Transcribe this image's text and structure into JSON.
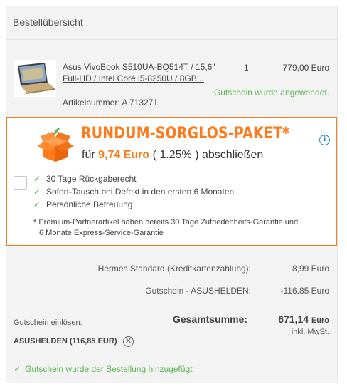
{
  "header": {
    "title": "Bestellübersicht"
  },
  "product": {
    "image_alt": "laptop-product-image",
    "name": "Asus VivoBook S510UA-BQ514T / 15,6\" Full-HD / Intel Core i5-8250U / 8GB...",
    "quantity": "1",
    "price": "779,00 Euro",
    "coupon_note": "Gutschein wurde angewendet.",
    "sku": "Artikelnummer: A 713271"
  },
  "care_package": {
    "title": "RUNDUM-SORGLOS-PAKET*",
    "price_prefix": "für ",
    "price_amount": "9,74 Euro",
    "price_middle": " ( 1.25% ) abschließen",
    "checked": false,
    "features": [
      "30 Tage Rückgaberecht",
      "Sofort-Tausch bei Defekt in den ersten 6 Monaten",
      "Persönliche Betreuung"
    ],
    "note_line1": "* Premium-Partnerartikel haben bereits 30 Tage Zufriedenheits-Garantie und",
    "note_line2": "6 Monate Express-Service-Garantie",
    "accent_color": "#ff7a1a"
  },
  "totals": {
    "shipping_label": "Hermes Standard (Kreditkartenzahlung):",
    "shipping_value": "8,99 Euro",
    "coupon_label": "Gutschein - ASUSHELDEN:",
    "coupon_value": "-116,85 Euro",
    "grand_label": "Gesamtsumme:",
    "grand_amount": "671,14",
    "grand_currency": "Euro",
    "vat_note": "inkl. MwSt."
  },
  "coupon": {
    "label": "Gutschein einlösen:",
    "code": "ASUSHELDEN (116,85 EUR)",
    "remove_symbol": "✕",
    "success_message": "Gutschein wurde der Bestellung hinzugefügt",
    "success_color": "#5ab552"
  }
}
